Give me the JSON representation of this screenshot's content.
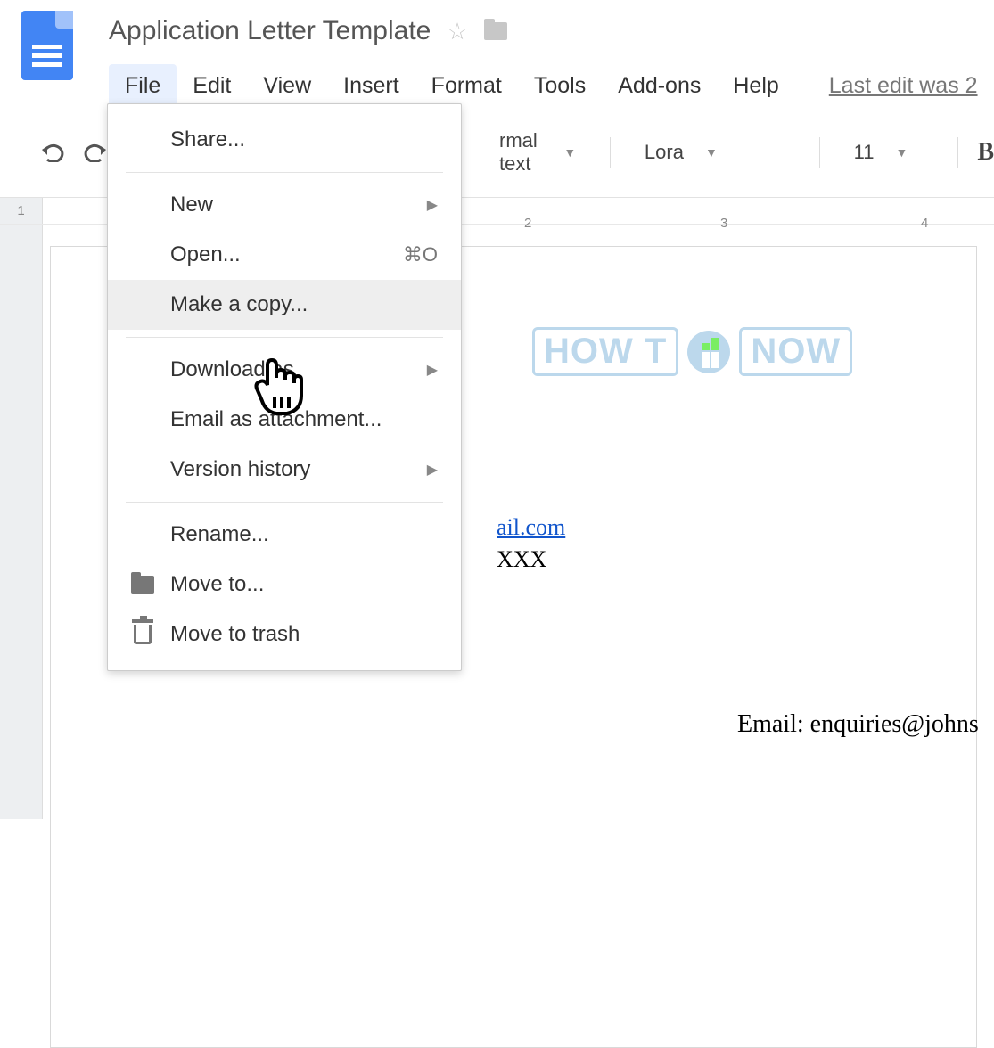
{
  "header": {
    "doc_title": "Application Letter Template",
    "last_edit": "Last edit was 2"
  },
  "menubar": {
    "items": [
      "File",
      "Edit",
      "View",
      "Insert",
      "Format",
      "Tools",
      "Add-ons",
      "Help"
    ]
  },
  "toolbar": {
    "style_select": "rmal text",
    "font_select": "Lora",
    "font_size": "11",
    "bold_label": "B"
  },
  "ruler": {
    "left_label": "1",
    "marks": [
      "2",
      "3",
      "4"
    ]
  },
  "file_menu": {
    "share": "Share...",
    "new": "New",
    "open": "Open...",
    "open_shortcut": "⌘O",
    "make_copy": "Make a copy...",
    "download": "Download as",
    "email_attach": "Email as attachment...",
    "version": "Version history",
    "rename": "Rename...",
    "move_to": "Move to...",
    "trash": "Move to trash"
  },
  "document": {
    "watermark_left": "HOW T",
    "watermark_right": "NOW",
    "link_fragment": "ail.com",
    "xxx_fragment": "XXX",
    "email_line": "Email: enquiries@johns"
  }
}
